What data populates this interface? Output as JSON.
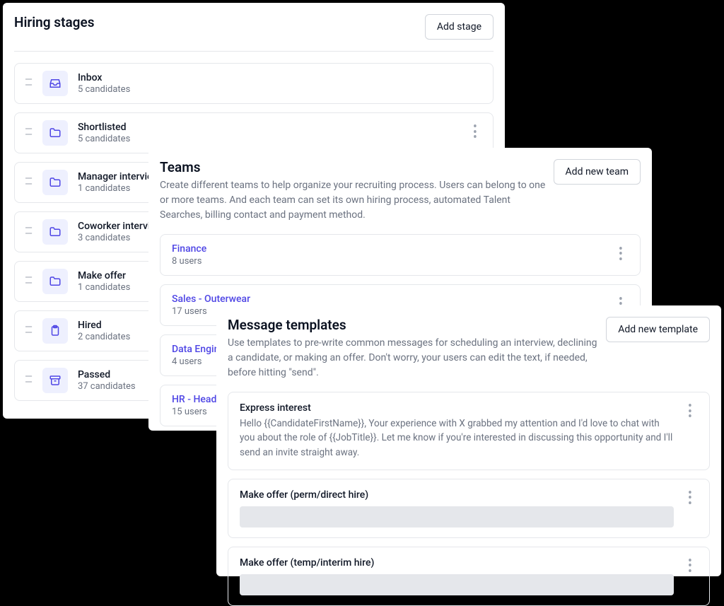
{
  "hiring": {
    "title": "Hiring stages",
    "add_btn": "Add stage",
    "stages": [
      {
        "name": "Inbox",
        "sub": "5 candidates",
        "icon": "inbox"
      },
      {
        "name": "Shortlisted",
        "sub": "5 candidates",
        "icon": "folder",
        "kebab": true
      },
      {
        "name": "Manager interview",
        "sub": "1 candidates",
        "icon": "folder"
      },
      {
        "name": "Coworker interview",
        "sub": "3 candidates",
        "icon": "folder"
      },
      {
        "name": "Make offer",
        "sub": "1 candidates",
        "icon": "folder"
      },
      {
        "name": "Hired",
        "sub": "2 candidates",
        "icon": "clipboard"
      },
      {
        "name": "Passed",
        "sub": "37 candidates",
        "icon": "archive"
      }
    ]
  },
  "teams": {
    "title": "Teams",
    "desc": "Create different teams to help organize your recruiting process. Users can belong to one or more teams. And each team can set its own hiring process, automated Talent Searches, billing contact and payment method.",
    "add_btn": "Add new team",
    "items": [
      {
        "name": "Finance",
        "sub": "8 users"
      },
      {
        "name": "Sales - Outerwear",
        "sub": "17 users"
      },
      {
        "name": "Data Engineering",
        "sub": "4 users"
      },
      {
        "name": "HR - Headquarters",
        "sub": "15 users"
      }
    ]
  },
  "templates": {
    "title": "Message templates",
    "desc": "Use templates to pre-write common messages for scheduling an interview, declining a candidate, or making an offer. Don't worry, your users can edit the text, if needed, before hitting \"send\".",
    "add_btn": "Add new template",
    "items": [
      {
        "name": "Express interest",
        "body": "Hello {{CandidateFirstName}}, Your experience with X grabbed my attention and I'd love to chat with you about the role of {{JobTitle}}. Let me know if you're interested in discussing this opportunity and I'll send an invite straight away."
      },
      {
        "name": "Make offer (perm/direct hire)",
        "body": ""
      },
      {
        "name": "Make offer (temp/interim hire)",
        "body": ""
      }
    ]
  }
}
